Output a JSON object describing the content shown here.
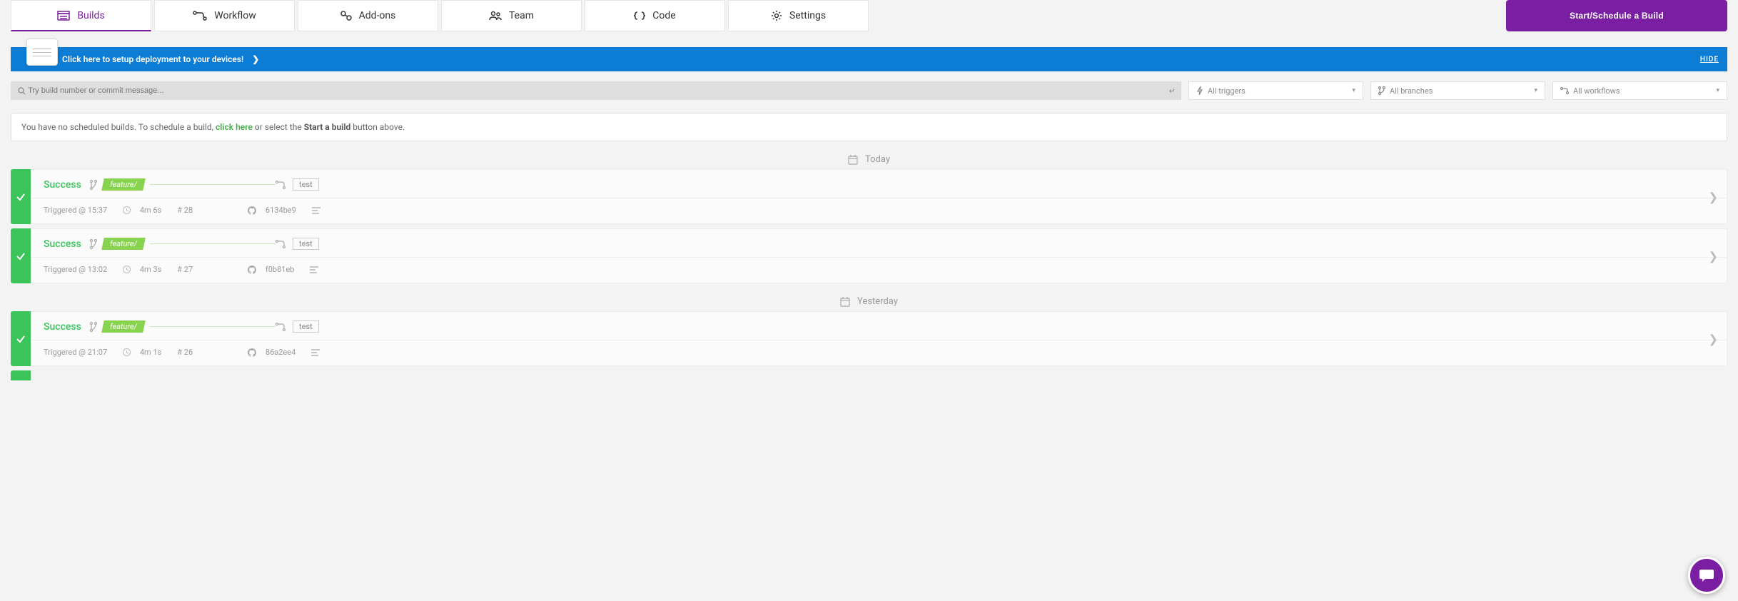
{
  "tabs": {
    "builds": "Builds",
    "workflow": "Workflow",
    "addons": "Add-ons",
    "team": "Team",
    "code": "Code",
    "settings": "Settings"
  },
  "start_build_btn": "Start/Schedule a Build",
  "banner": {
    "text": "Click here to setup deployment to your devices!",
    "hide": "HIDE"
  },
  "search": {
    "placeholder": "Try build number or commit message..."
  },
  "filters": {
    "triggers": "All triggers",
    "branches": "All branches",
    "workflows": "All workflows"
  },
  "notice": {
    "prefix": "You have no scheduled builds. To schedule a build, ",
    "link": "click here",
    "mid": " or select the ",
    "bold": "Start a build",
    "suffix": " button above."
  },
  "day": {
    "today": "Today",
    "yesterday": "Yesterday"
  },
  "builds": [
    {
      "status": "Success",
      "branch": "feature/",
      "workflow": "test",
      "triggered": "Triggered @ 15:37",
      "duration": "4m 6s",
      "num": "# 28",
      "commit": "6134be9"
    },
    {
      "status": "Success",
      "branch": "feature/",
      "workflow": "test",
      "triggered": "Triggered @ 13:02",
      "duration": "4m 3s",
      "num": "# 27",
      "commit": "f0b81eb"
    },
    {
      "status": "Success",
      "branch": "feature/",
      "workflow": "test",
      "triggered": "Triggered @ 21:07",
      "duration": "4m 1s",
      "num": "# 26",
      "commit": "86a2ee4"
    }
  ]
}
